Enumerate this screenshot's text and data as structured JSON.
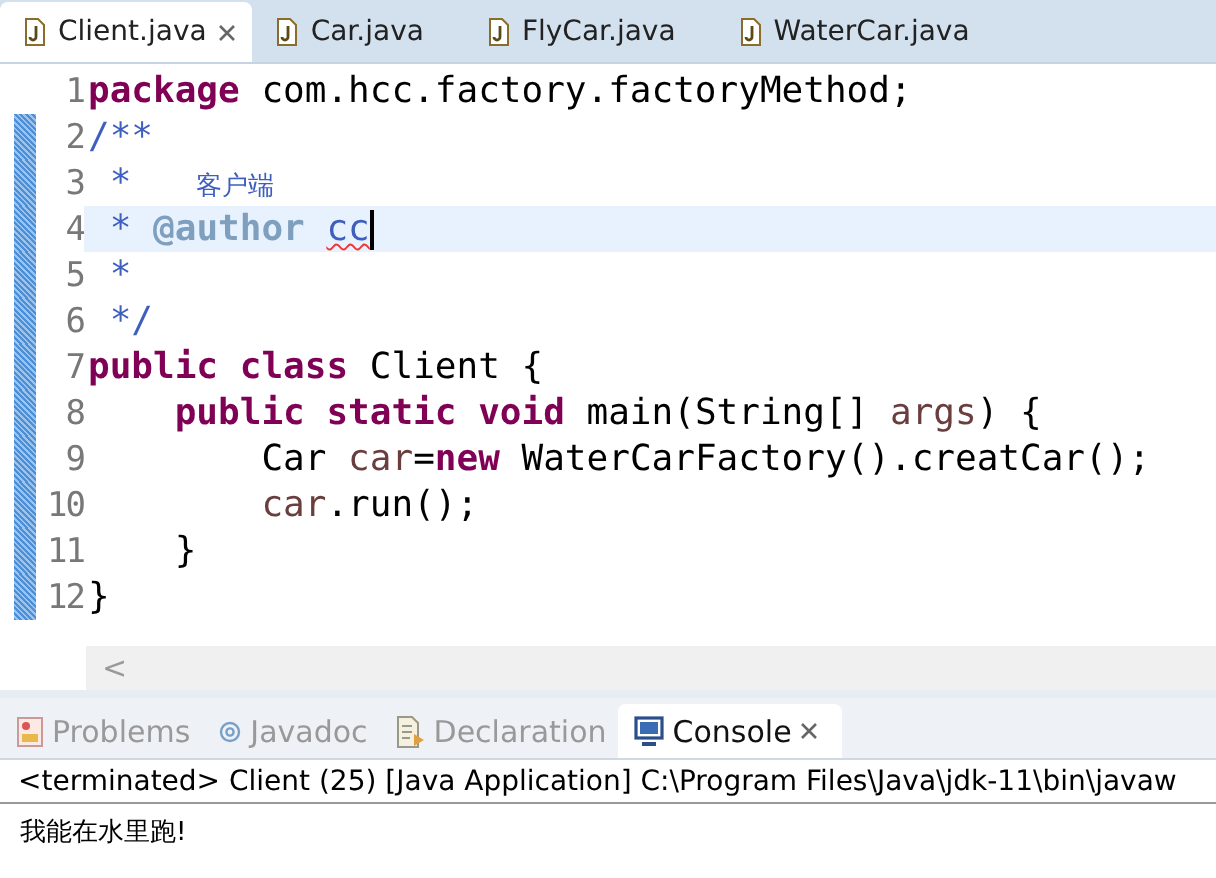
{
  "editor_tabs": [
    {
      "label": "Client.java",
      "selected": true
    },
    {
      "label": "Car.java",
      "selected": false
    },
    {
      "label": "FlyCar.java",
      "selected": false
    },
    {
      "label": "WaterCar.java",
      "selected": false
    }
  ],
  "code_lines": [
    {
      "number": "1",
      "current": false,
      "changed": false,
      "tokens": [
        {
          "kind": "keyword",
          "text": "package"
        },
        {
          "kind": "plain",
          "text": " com.hcc.factory.factoryMethod;"
        }
      ]
    },
    {
      "number": "2",
      "current": false,
      "changed": true,
      "tokens": [
        {
          "kind": "comment",
          "text": "/**"
        }
      ]
    },
    {
      "number": "3",
      "current": false,
      "changed": true,
      "tokens": [
        {
          "kind": "comment",
          "text": " *   "
        },
        {
          "kind": "cjk",
          "text": "客户端"
        }
      ]
    },
    {
      "number": "4",
      "current": true,
      "changed": true,
      "tokens": [
        {
          "kind": "comment",
          "text": " * "
        },
        {
          "kind": "tag",
          "text": "@author "
        },
        {
          "kind": "misspelled",
          "text": "cc"
        }
      ]
    },
    {
      "number": "5",
      "current": false,
      "changed": true,
      "tokens": [
        {
          "kind": "comment",
          "text": " *"
        }
      ]
    },
    {
      "number": "6",
      "current": false,
      "changed": true,
      "tokens": [
        {
          "kind": "comment",
          "text": " */"
        }
      ]
    },
    {
      "number": "7",
      "current": false,
      "changed": true,
      "tokens": [
        {
          "kind": "keyword",
          "text": "public"
        },
        {
          "kind": "keyword",
          "text": " class"
        },
        {
          "kind": "plain",
          "text": " Client {"
        }
      ]
    },
    {
      "number": "8",
      "current": false,
      "changed": true,
      "tokens": [
        {
          "kind": "keyword",
          "text": "    public"
        },
        {
          "kind": "keyword",
          "text": " static"
        },
        {
          "kind": "keyword",
          "text": " void"
        },
        {
          "kind": "plain",
          "text": " main(String[] "
        },
        {
          "kind": "variable",
          "text": "args"
        },
        {
          "kind": "plain",
          "text": ") {"
        }
      ]
    },
    {
      "number": "9",
      "current": false,
      "changed": true,
      "tokens": [
        {
          "kind": "plain",
          "text": "        Car "
        },
        {
          "kind": "variable",
          "text": "car"
        },
        {
          "kind": "plain",
          "text": "="
        },
        {
          "kind": "keyword",
          "text": "new"
        },
        {
          "kind": "plain",
          "text": " WaterCarFactory().creatCar();"
        }
      ]
    },
    {
      "number": "10",
      "current": false,
      "changed": true,
      "tokens": [
        {
          "kind": "variable",
          "text": "        car"
        },
        {
          "kind": "plain",
          "text": ".run();"
        }
      ]
    },
    {
      "number": "11",
      "current": false,
      "changed": true,
      "tokens": [
        {
          "kind": "plain",
          "text": "    }"
        }
      ]
    },
    {
      "number": "12",
      "current": false,
      "changed": true,
      "tokens": [
        {
          "kind": "plain",
          "text": "}"
        }
      ]
    }
  ],
  "scroll_left": "<",
  "panel_tabs": [
    {
      "label": "Problems",
      "selected": false,
      "kind": "problems"
    },
    {
      "label": "Javadoc",
      "selected": false,
      "kind": "javadoc"
    },
    {
      "label": "Declaration",
      "selected": false,
      "kind": "declaration"
    },
    {
      "label": "Console",
      "selected": true,
      "kind": "console"
    }
  ],
  "console": {
    "header": "<terminated> Client (25) [Java Application] C:\\Program Files\\Java\\jdk-11\\bin\\javaw",
    "output": "我能在水里跑!"
  }
}
